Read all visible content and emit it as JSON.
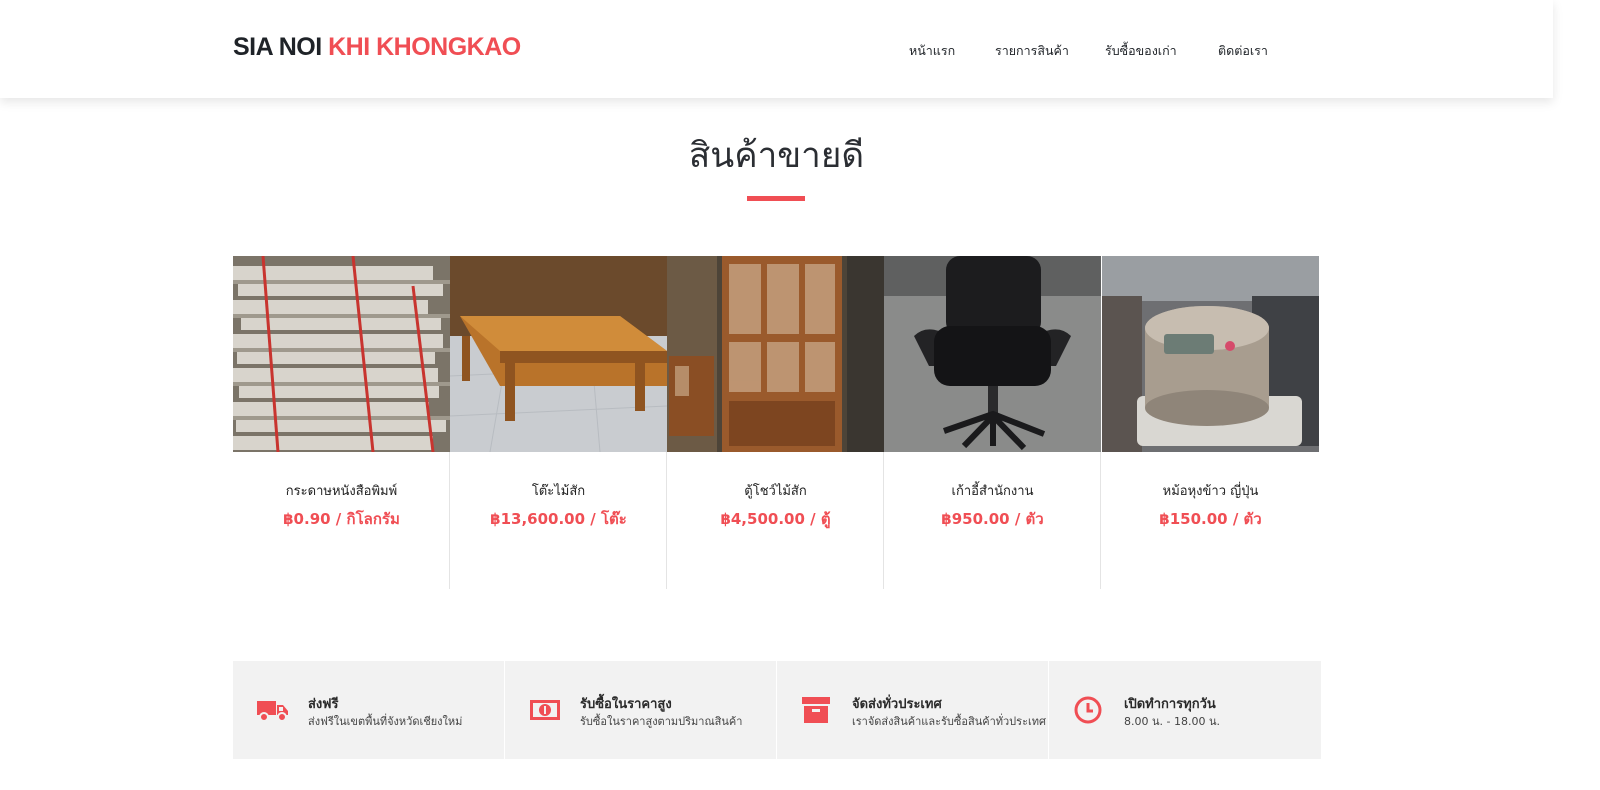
{
  "brand": {
    "part1": "SIA NOI",
    "part2": "KHI KHONGKAO"
  },
  "nav": [
    "หน้าแรก",
    "รายการสินค้า",
    "รับซื้อของเก่า",
    "ติดต่อเรา"
  ],
  "section": {
    "title": "สินค้าขายดี"
  },
  "products": [
    {
      "name": "กระดาษหนังสือพิมพ์",
      "price": "฿0.90 / กิโลกรัม",
      "image": "newspaper-stack"
    },
    {
      "name": "โต๊ะไม้สัก",
      "price": "฿13,600.00 / โต๊ะ",
      "image": "teak-table"
    },
    {
      "name": "ตู้โชว์ไม้สัก",
      "price": "฿4,500.00 / ตู้",
      "image": "teak-cabinet"
    },
    {
      "name": "เก้าอี้สำนักงาน",
      "price": "฿950.00 / ตัว",
      "image": "office-chair"
    },
    {
      "name": "หม้อหุงข้าว ญี่ปุ่น",
      "price": "฿150.00 / ตัว",
      "image": "rice-cooker"
    }
  ],
  "features": [
    {
      "title": "ส่งฟรี",
      "desc": "ส่งฟรีในเขตพื้นที่จังหวัดเชียงใหม่",
      "icon": "truck-icon"
    },
    {
      "title": "รับซื้อในราคาสูง",
      "desc": "รับซื้อในราคาสูงตามปริมาณสินค้า",
      "icon": "money-icon"
    },
    {
      "title": "จัดส่งทั่วประเทศ",
      "desc": "เราจัดส่งสินค้าและรับซื้อสินค้าทั่วประเทศ",
      "icon": "box-icon"
    },
    {
      "title": "เปิดทำการทุกวัน",
      "desc": "8.00 น. - 18.00 น.",
      "icon": "clock-icon"
    }
  ],
  "colors": {
    "accent": "#f04e54",
    "dark": "#1f2328",
    "feature_bg": "#f2f2f2"
  }
}
